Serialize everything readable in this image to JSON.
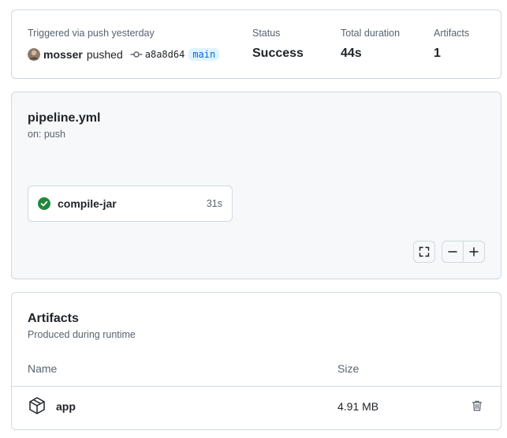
{
  "summary": {
    "trigger_text": "Triggered via push yesterday",
    "actor": "mosser",
    "action": "pushed",
    "commit_sha": "a8a8d64",
    "branch": "main",
    "status_label": "Status",
    "status_value": "Success",
    "duration_label": "Total duration",
    "duration_value": "44s",
    "artifacts_label": "Artifacts",
    "artifacts_value": "1",
    "icons": {
      "avatar": "user-avatar",
      "commit": "git-commit-icon"
    }
  },
  "workflow": {
    "name": "pipeline.yml",
    "trigger": "on: push",
    "jobs": [
      {
        "name": "compile-jar",
        "duration": "31s",
        "status": "success",
        "icon": "check-circle-fill-icon"
      }
    ],
    "controls": {
      "fullscreen_icon": "fullscreen-icon",
      "zoom_out_icon": "minus-icon",
      "zoom_in_icon": "plus-icon"
    }
  },
  "artifacts_section": {
    "title": "Artifacts",
    "subtitle": "Produced during runtime",
    "columns": {
      "name": "Name",
      "size": "Size"
    },
    "rows": [
      {
        "name": "app",
        "size": "4.91 MB",
        "icon": "package-icon",
        "delete_icon": "trash-icon"
      }
    ]
  },
  "colors": {
    "success": "#1f883d",
    "link": "#0969da",
    "branch_bg": "#ddf4ff",
    "border": "#d1d9e0",
    "muted_text": "#59636e",
    "canvas_subtle": "#f6f8fa"
  }
}
